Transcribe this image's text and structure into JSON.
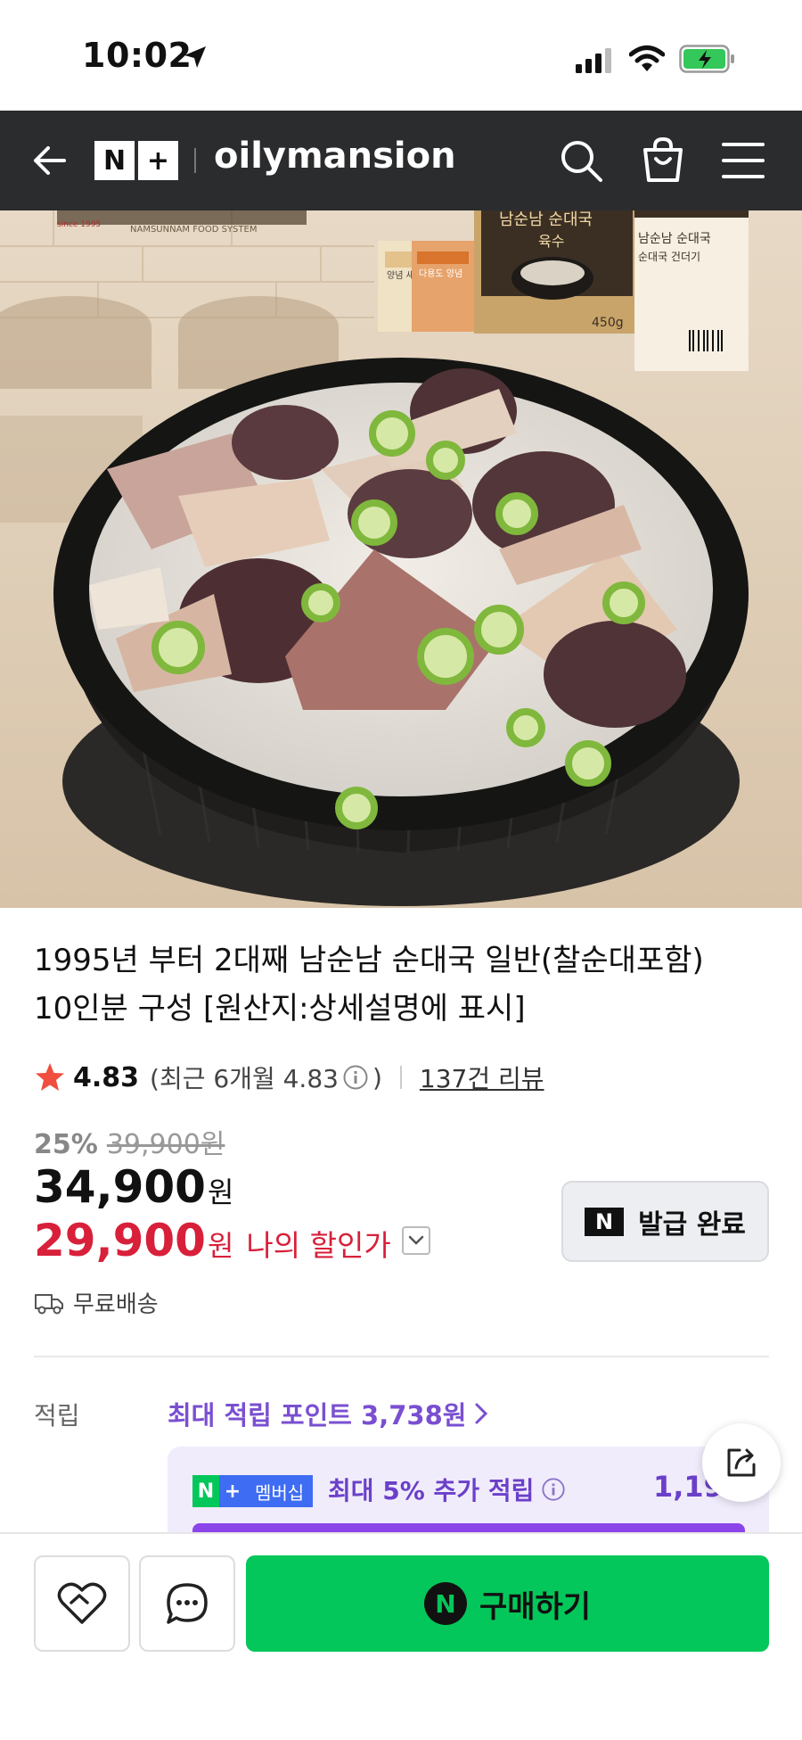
{
  "status_bar": {
    "time": "10:02",
    "icons": [
      "location-arrow-icon",
      "cellular-signal-icon",
      "wifi-icon",
      "battery-charging-icon"
    ]
  },
  "header": {
    "logo_left": "N",
    "logo_right": "+",
    "store_name": "oilymansion",
    "icons": [
      "back-arrow-icon",
      "search-icon",
      "shopping-bag-icon",
      "menu-icon"
    ],
    "background": "#2b2c2e"
  },
  "product_image": {
    "brand_tagline": "NAMSUNNAM FOOD SYSTEM",
    "since": "since 1995",
    "package_title": "남순남 순대국",
    "package_subtitle": "육수",
    "package_weight": "450g",
    "package2_title": "남순남 순대국",
    "package2_subtitle": "순대국 건더기",
    "sauce1": "양념 새",
    "sauce2": "다용도 양념"
  },
  "product": {
    "title_line1": "1995년 부터 2대째 남순남 순대국 일반(찰순대포함)",
    "title_line2": "10인분 구성 [원산지:상세설명에 표시]",
    "rating": "4.83",
    "rating_recent_prefix": "(최근 6개월 4.83",
    "rating_recent_suffix": ")",
    "review_count": "137건 리뷰",
    "discount_rate": "25%",
    "original_price": "39,900원",
    "price": "34,900",
    "price_unit": "원",
    "my_price": "29,900",
    "my_price_unit": "원",
    "my_price_label": "나의 할인가",
    "coupon_label": "발급 완료",
    "coupon_icon_text": "N",
    "shipping": "무료배송"
  },
  "points": {
    "label": "적립",
    "max_text": "최대 적립 포인트 3,738원",
    "membership_badge": "멤버십",
    "membership_text": "최대 5% 추가 적립",
    "membership_amount": "1,190",
    "accent_color": "#7a4fd1"
  },
  "bottom_bar": {
    "buy_label": "구매하기",
    "buy_icon_text": "N",
    "buy_color": "#03c75a",
    "icons": [
      "wishlist-heart-icon",
      "talk-chat-icon"
    ]
  },
  "colors": {
    "discount_red": "#d8203a",
    "naver_green": "#03c75a"
  }
}
